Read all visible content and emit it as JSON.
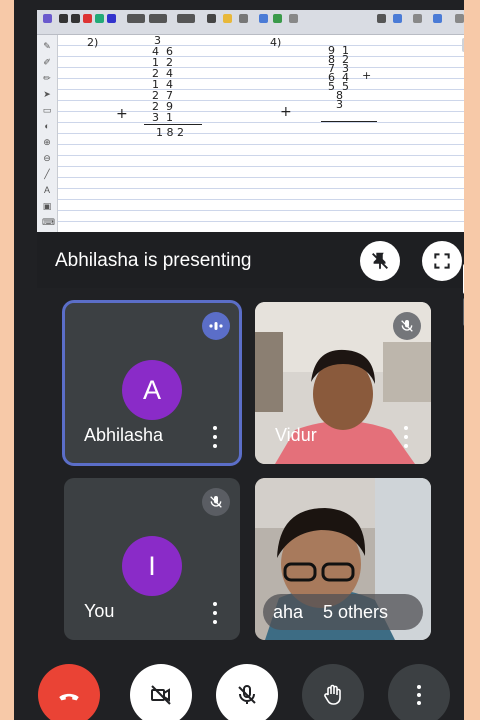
{
  "whiteboard": {
    "problem_a": {
      "number": "2)",
      "rows": [
        "3",
        "4  6",
        "1  2",
        "2  4",
        "1  4",
        "2  7",
        "2  9",
        "3  1"
      ],
      "operator": "+",
      "answer": "1 8 2"
    },
    "problem_b": {
      "number": "4)",
      "rows": [
        "9  1",
        "8  2",
        "7  3",
        "6  4",
        "5  5",
        "8",
        "3"
      ],
      "operator": "+"
    }
  },
  "presentation": {
    "text": "Abhilasha is presenting"
  },
  "participants": [
    {
      "name": "Abhilasha",
      "avatar_letter": "A",
      "status": "speaking",
      "avatar_color": "#8a2bc8"
    },
    {
      "name": "Vidur",
      "status": "muted"
    },
    {
      "name": "You",
      "avatar_letter": "I",
      "status": "muted",
      "avatar_color": "#8a2bc8"
    },
    {
      "name": "aha",
      "others": "5 others"
    }
  ],
  "controls": {
    "end_call_color": "#ea4335",
    "items": [
      "end-call",
      "camera-off",
      "mic-off",
      "raise-hand",
      "more-options"
    ]
  },
  "colors": {
    "background": "#202124",
    "tile": "#3c4043",
    "active_outline": "#5b6ec8",
    "speaking_badge": "#5b6ec8"
  }
}
